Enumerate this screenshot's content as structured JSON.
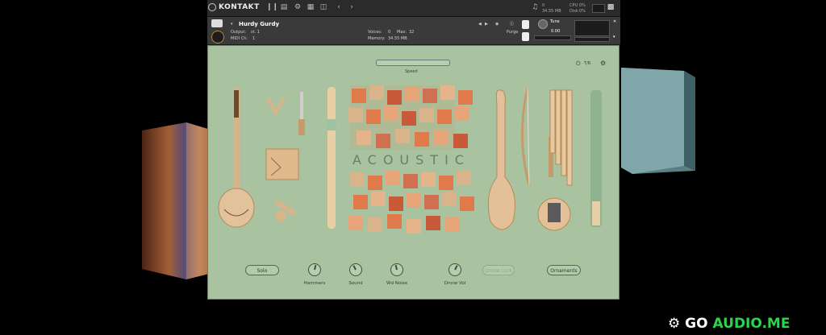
{
  "app": {
    "name": "KONTAKT"
  },
  "topbar": {
    "cpu_label": "CPU",
    "cpu_value": "0%",
    "disk_label": "Disk",
    "disk_value": "0%",
    "voices_value": "0",
    "memory_value": "34.55 MB"
  },
  "header": {
    "instrument_name": "Hurdy Gurdy",
    "output_label": "Output:",
    "output_value": "st. 1",
    "midi_label": "MIDI Ch:",
    "midi_value": "1",
    "voices_label": "Voices:",
    "voices_value": "0",
    "max_label": "Max:",
    "max_value": "32",
    "memory_label": "Memory:",
    "memory_value": "34.55 MB",
    "purge_label": "Purge",
    "tune_label": "Tune",
    "tune_value": "0.00"
  },
  "panel": {
    "speed_label": "Speed",
    "acoustic_title": "ACOUSTIC",
    "power_label": "T/R",
    "buttons": {
      "solo": "Solo",
      "drone_lock": "Drone Lock",
      "ornaments": "Ornaments"
    },
    "knobs": [
      {
        "label": "Hammers",
        "value": 0.55
      },
      {
        "label": "Sound",
        "value": 0.4
      },
      {
        "label": "Wd Noise",
        "value": 0.45
      },
      {
        "label": "Drone Vol",
        "value": 0.6
      }
    ]
  },
  "watermark": {
    "prefix": "GO",
    "suffix": "AUDIO.ME"
  },
  "colors": {
    "panel_bg": "#a9c3a0",
    "accent_orange": "#e07a4a",
    "wood": "#d9b48a",
    "watermark_green": "#2bd44a"
  }
}
